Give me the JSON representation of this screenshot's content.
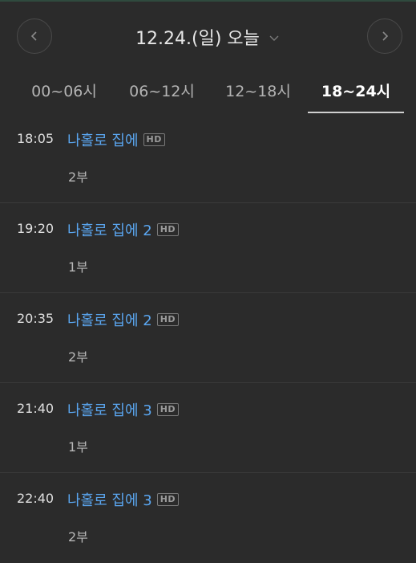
{
  "header": {
    "date_label": "12.24.(일) 오늘",
    "icons": {
      "prev": "chevron-left-icon",
      "next": "chevron-right-icon",
      "dropdown": "chevron-down-icon"
    }
  },
  "tabs": [
    {
      "label": "00~06시",
      "active": false
    },
    {
      "label": "06~12시",
      "active": false
    },
    {
      "label": "12~18시",
      "active": false
    },
    {
      "label": "18~24시",
      "active": true
    }
  ],
  "schedule": [
    {
      "time": "18:05",
      "title": "나홀로 집에",
      "badge": "HD",
      "episode": "2부"
    },
    {
      "time": "19:20",
      "title": "나홀로 집에 2",
      "badge": "HD",
      "episode": "1부"
    },
    {
      "time": "20:35",
      "title": "나홀로 집에 2",
      "badge": "HD",
      "episode": "2부"
    },
    {
      "time": "21:40",
      "title": "나홀로 집에 3",
      "badge": "HD",
      "episode": "1부"
    },
    {
      "time": "22:40",
      "title": "나홀로 집에 3",
      "badge": "HD",
      "episode": "2부"
    }
  ],
  "colors": {
    "background": "#2b2b2b",
    "title_link": "#5aa6f0",
    "active_tab": "#ffffff"
  }
}
